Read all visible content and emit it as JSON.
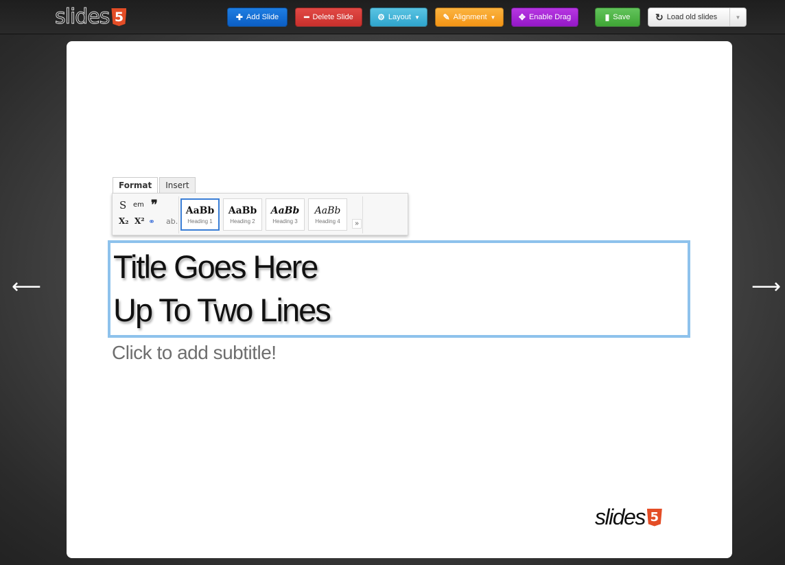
{
  "app": {
    "logo_text": "slides",
    "logo_badge": "5"
  },
  "toolbar": {
    "add_slide": "Add Slide",
    "delete_slide": "Delete Slide",
    "layout": "Layout",
    "alignment": "Alignment",
    "enable_drag": "Enable Drag",
    "save": "Save",
    "load_old_slides": "Load old slides"
  },
  "editor": {
    "tabs": [
      "Format",
      "Insert"
    ],
    "format_buttons": {
      "strike": "S",
      "em": "em",
      "quote": "❞",
      "subscript": "X₂",
      "superscript": "X²",
      "link": "⚭",
      "abbr": "ab."
    },
    "styles": [
      {
        "sample": "AaBb",
        "label": "Heading 1"
      },
      {
        "sample": "AaBb",
        "label": "Heading 2"
      },
      {
        "sample": "AaBb",
        "label": "Heading 3"
      },
      {
        "sample": "AaBb",
        "label": "Heading 4"
      }
    ]
  },
  "slide": {
    "title_line1": "Title Goes Here",
    "title_line2": "Up To Two Lines",
    "subtitle": "Click to add subtitle!",
    "footer_logo_text": "slides",
    "footer_logo_badge": "5"
  },
  "nav": {
    "prev": "⟵",
    "next": "⟶"
  },
  "colors": {
    "add": "#1f7ee2",
    "delete": "#e24a46",
    "layout": "#5ac4e3",
    "alignment": "#fbb440",
    "drag": "#b737e2",
    "save": "#63c45c",
    "title_border": "#8ec2ec",
    "html5_badge": "#e44d26"
  }
}
